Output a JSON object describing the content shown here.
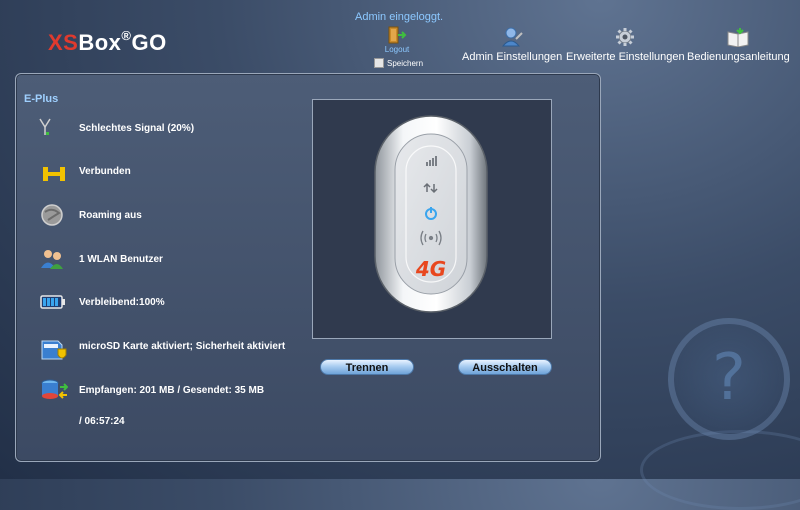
{
  "header": {
    "logo_xs": "XS",
    "logo_box": "Box",
    "logo_reg": "®",
    "logo_go": "GO",
    "admin_status": "Admin eingeloggt.",
    "logout_label": "Logout",
    "save_label": "Speichern",
    "nav": [
      {
        "label": "Admin Einstellungen",
        "icon": "admin-user-icon"
      },
      {
        "label": "Erweiterte Einstellungen",
        "icon": "gear-icon"
      },
      {
        "label": "Bedienungsanleitung",
        "icon": "manual-book-icon"
      }
    ]
  },
  "status": {
    "carrier": "E-Plus",
    "signal": "Schlechtes Signal (20%)",
    "connection": "Verbunden",
    "roaming": "Roaming aus",
    "wlan_users": "1 WLAN Benutzer",
    "battery": "Verbleibend:100%",
    "sd_card": "microSD Karte aktiviert; Sicherheit aktiviert",
    "traffic": "Empfangen: 201 MB / Gesendet: 35 MB",
    "duration": "/ 06:57:24"
  },
  "device": {
    "badge": "4G",
    "accent": "#e8471e",
    "led_blue": "#3aa5ee"
  },
  "actions": {
    "disconnect_label": "Trennen",
    "shutdown_label": "Ausschalten"
  },
  "help": {
    "symbol": "?"
  }
}
